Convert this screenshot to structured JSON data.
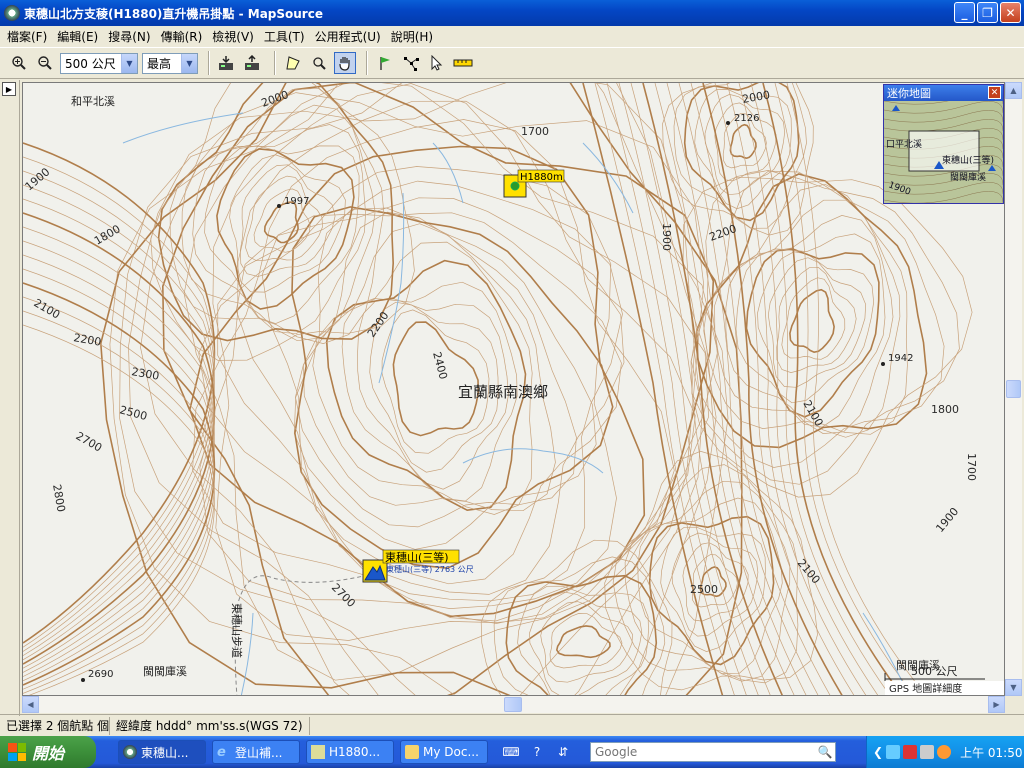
{
  "window": {
    "title": "東穗山北方支稜(H1880)直升機吊掛點 - MapSource",
    "minimize": "_",
    "maximize": "❐",
    "close": "✕"
  },
  "menu": [
    {
      "label": "檔案(F)"
    },
    {
      "label": "編輯(E)"
    },
    {
      "label": "搜尋(N)"
    },
    {
      "label": "傳輸(R)"
    },
    {
      "label": "檢視(V)"
    },
    {
      "label": "工具(T)"
    },
    {
      "label": "公用程式(U)"
    },
    {
      "label": "說明(H)"
    }
  ],
  "toolbar": {
    "scale_value": "500 公尺",
    "detail_value": "最高"
  },
  "map": {
    "region_label": "宜蘭縣南澳鄉",
    "place_labels": [
      "和平北溪",
      "閩閩庫溪",
      "閩閩庫溪",
      "東穗山步道"
    ],
    "contour_labels": [
      "1700",
      "1900",
      "1800",
      "2100",
      "2200",
      "2300",
      "2500",
      "2700",
      "2800",
      "2200",
      "2400",
      "1900",
      "2200",
      "2000",
      "2100",
      "1800",
      "1700",
      "1900",
      "2100",
      "2500",
      "2700",
      "2000"
    ],
    "spot_heights": [
      "1997",
      "2126",
      "1942",
      "2690"
    ],
    "waypoint_h1880": "H1880m",
    "summit_label": "東穗山(三等)",
    "summit_sub": "東穗山(三等) 2763 公尺",
    "scale_label": "500 公尺",
    "detail_note": "GPS 地圖詳細度"
  },
  "minimap": {
    "title": "迷你地圖",
    "close": "✕",
    "labels": [
      "東穗山(三等)",
      "口平北溪",
      "閩閩庫溪",
      "1900"
    ]
  },
  "status": {
    "selection": "已選擇 2 個航點 個",
    "coord_format": "經緯度 hddd° mm'ss.s(WGS 72)"
  },
  "taskbar": {
    "start": "開始",
    "tasks": [
      "東穗山...",
      "登山補...",
      "H1880...",
      "My Doc..."
    ],
    "search_placeholder": "Google",
    "clock": "上午 01:50"
  },
  "colors": {
    "contour": "#b07e4b",
    "contour_light": "#c8a27b",
    "stream": "#8ab8e0",
    "waypoint_fill": "#ffe100",
    "title_blue": "#0a4fd0"
  }
}
